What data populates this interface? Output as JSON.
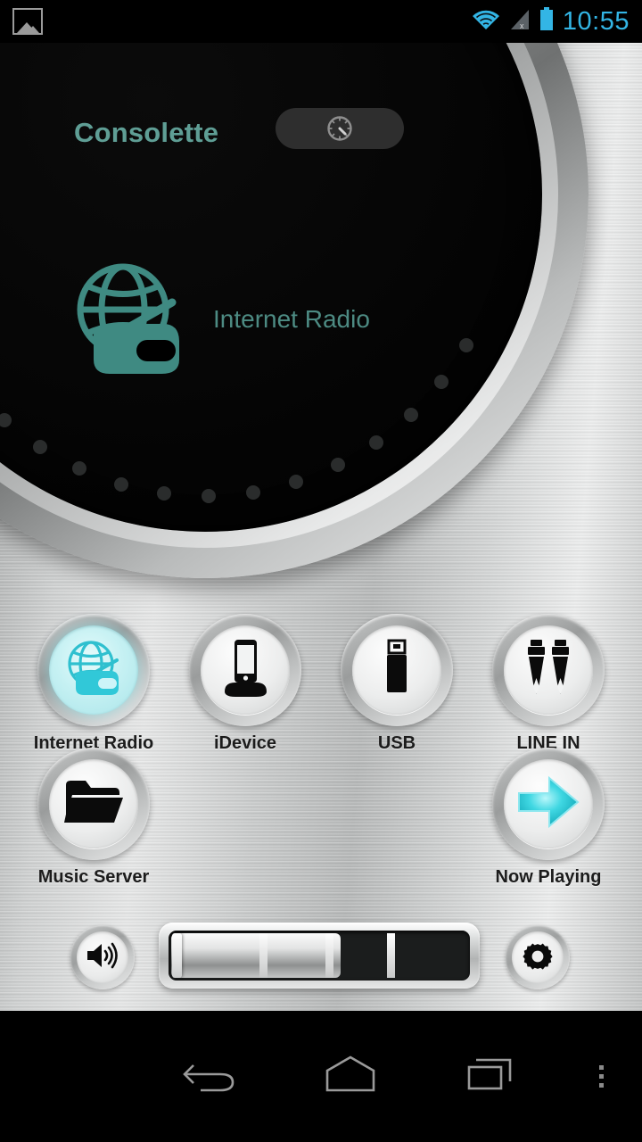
{
  "status_bar": {
    "left_icon": "gallery-icon",
    "icons": [
      "wifi-icon",
      "signal-off-icon",
      "battery-icon"
    ],
    "time": "10:55",
    "accent_color": "#33b5e5"
  },
  "app": {
    "title": "Consolette",
    "title_color": "#5f9e95",
    "timer_button": {
      "icon": "sleep-timer-clock-icon",
      "label": ""
    }
  },
  "display": {
    "source_name": "Internet Radio",
    "source_icon": "internet-radio-globe-icon",
    "text_color": "#4d8b83",
    "dial": {
      "total_dots": 18,
      "lit_dots": 2,
      "lit_color": "#4fbdb2",
      "unlit_color": "#2a2c2c"
    }
  },
  "sources": {
    "row1": [
      {
        "label": "Internet Radio",
        "icon": "internet-radio-globe-icon",
        "active": true
      },
      {
        "label": "iDevice",
        "icon": "idevice-dock-icon",
        "active": false
      },
      {
        "label": "USB",
        "icon": "usb-drive-icon",
        "active": false
      },
      {
        "label": "LINE IN",
        "icon": "rca-plugs-icon",
        "active": false
      }
    ],
    "row2": [
      {
        "label": "Music Server",
        "icon": "folder-icon",
        "active": false
      },
      {
        "label": "Now Playing",
        "icon": "arrow-right-icon",
        "active": false
      }
    ]
  },
  "controls": {
    "volume_button": {
      "icon": "speaker-volume-icon",
      "label": ""
    },
    "settings_button": {
      "icon": "gear-icon",
      "label": ""
    },
    "volume_slider": {
      "value_percent": 58,
      "segments": 4
    }
  },
  "navbar": {
    "items": [
      {
        "name": "back",
        "icon": "back-arrow-icon"
      },
      {
        "name": "home",
        "icon": "home-icon"
      },
      {
        "name": "recents",
        "icon": "recents-icon"
      },
      {
        "name": "menu",
        "icon": "overflow-menu-icon"
      }
    ]
  }
}
